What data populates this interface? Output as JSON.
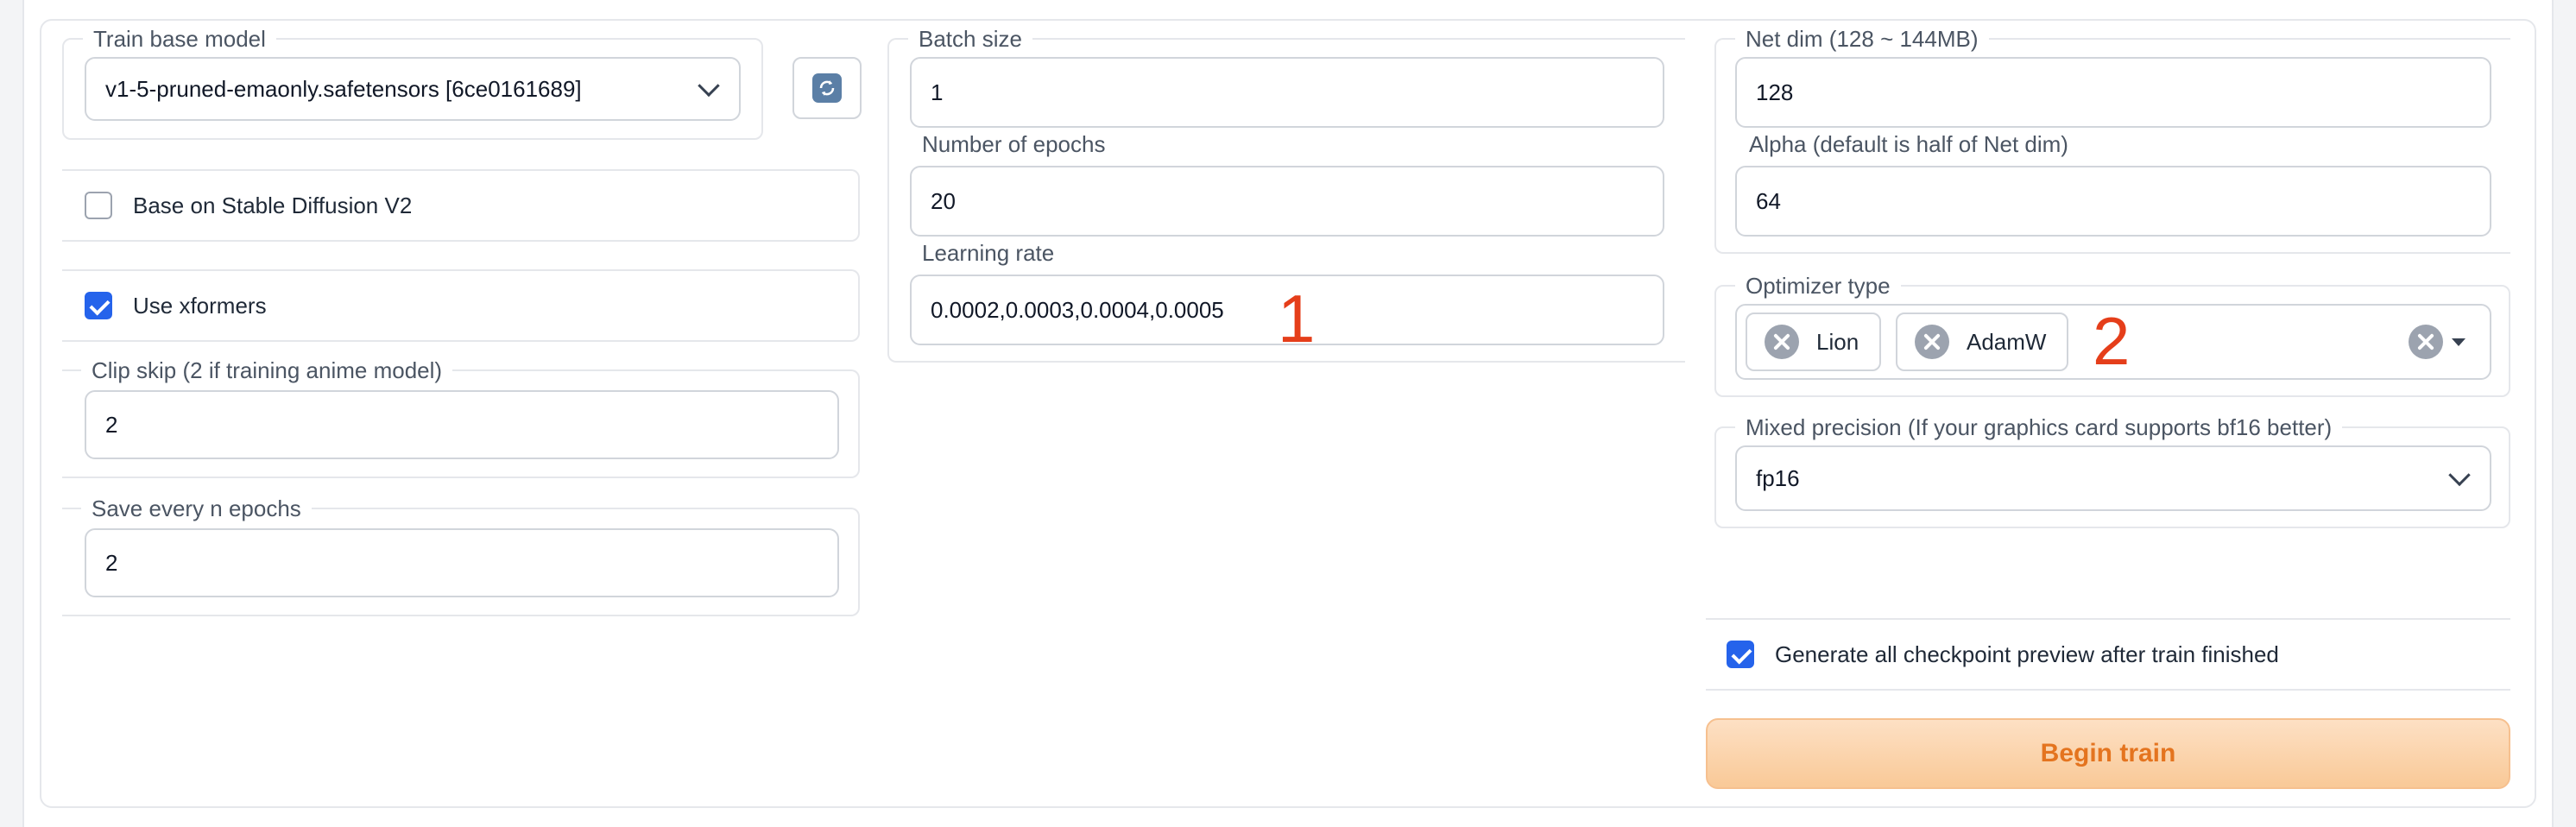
{
  "left": {
    "base_model": {
      "label": "Train base model",
      "value": "v1-5-pruned-emaonly.safetensors [6ce0161689]"
    },
    "sd_v2": {
      "label": "Base on Stable Diffusion V2",
      "checked": false
    },
    "xformers": {
      "label": "Use xformers",
      "checked": true
    },
    "clip_skip": {
      "label": "Clip skip (2 if training anime model)",
      "value": "2"
    },
    "save_every": {
      "label": "Save every n epochs",
      "value": "2"
    }
  },
  "middle": {
    "batch_size": {
      "label": "Batch size",
      "value": "1"
    },
    "epochs": {
      "label": "Number of epochs",
      "value": "20"
    },
    "learning_rate": {
      "label": "Learning rate",
      "value": "0.0002,0.0003,0.0004,0.0005"
    }
  },
  "right": {
    "net_dim": {
      "label": "Net dim (128 ~ 144MB)",
      "value": "128"
    },
    "alpha": {
      "label": "Alpha (default is half of Net dim)",
      "value": "64"
    },
    "optimizer": {
      "label": "Optimizer type",
      "selected": [
        "Lion",
        "AdamW"
      ]
    },
    "mixed_precision": {
      "label": "Mixed precision (If your graphics card supports bf16 better)",
      "value": "fp16"
    },
    "preview": {
      "label": "Generate all checkpoint preview after train finished",
      "checked": true
    },
    "begin_train_label": "Begin train"
  },
  "annotations": {
    "one": "1",
    "two": "2"
  },
  "colors": {
    "accent": "#2563eb",
    "button_text": "#e4741f",
    "annotation": "#e53e1a"
  },
  "icons": {
    "refresh": "refresh-icon",
    "dropdown": "chevron-down-icon",
    "remove": "close-circle-icon"
  }
}
